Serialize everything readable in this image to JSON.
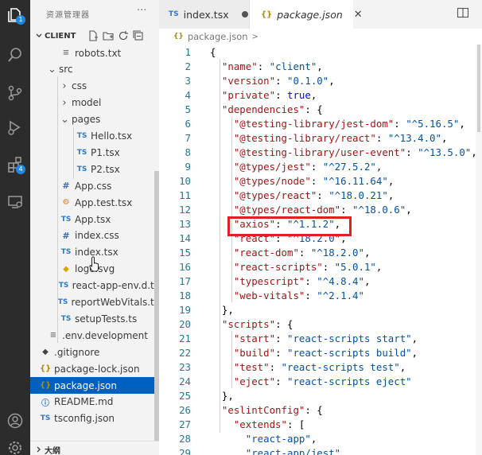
{
  "activity_bar": [
    {
      "name": "explorer-icon",
      "badge": "1"
    },
    {
      "name": "search-icon",
      "badge": ""
    },
    {
      "name": "source-control-icon",
      "badge": ""
    },
    {
      "name": "run-debug-icon",
      "badge": ""
    },
    {
      "name": "extensions-icon",
      "badge": "4"
    },
    {
      "name": "remote-explorer-icon",
      "badge": ""
    },
    {
      "name": "account-icon",
      "badge": ""
    },
    {
      "name": "settings-gear-icon",
      "badge": ""
    }
  ],
  "sidebar": {
    "title": "资源管理器",
    "more": "···",
    "section": "CLIENT",
    "outline": "大纲",
    "tree": [
      {
        "label": "robots.txt",
        "icon": "≡",
        "cls": "txt",
        "indent": 1,
        "chevron": ""
      },
      {
        "label": "src",
        "icon": "",
        "cls": "",
        "indent": 0,
        "chevron": "v"
      },
      {
        "label": "css",
        "icon": "",
        "cls": "",
        "indent": 1,
        "chevron": ">"
      },
      {
        "label": "model",
        "icon": "",
        "cls": "",
        "indent": 1,
        "chevron": ">"
      },
      {
        "label": "pages",
        "icon": "",
        "cls": "",
        "indent": 1,
        "chevron": "v"
      },
      {
        "label": "Hello.tsx",
        "icon": "TS",
        "cls": "ts",
        "indent": 2,
        "chevron": ""
      },
      {
        "label": "P1.tsx",
        "icon": "TS",
        "cls": "ts",
        "indent": 2,
        "chevron": ""
      },
      {
        "label": "P2.tsx",
        "icon": "TS",
        "cls": "ts",
        "indent": 2,
        "chevron": ""
      },
      {
        "label": "App.css",
        "icon": "#",
        "cls": "css",
        "indent": 1,
        "chevron": ""
      },
      {
        "label": "App.test.tsx",
        "icon": "⚙",
        "cls": "test",
        "indent": 1,
        "chevron": ""
      },
      {
        "label": "App.tsx",
        "icon": "TS",
        "cls": "ts",
        "indent": 1,
        "chevron": ""
      },
      {
        "label": "index.css",
        "icon": "#",
        "cls": "css",
        "indent": 1,
        "chevron": ""
      },
      {
        "label": "index.tsx",
        "icon": "TS",
        "cls": "ts",
        "indent": 1,
        "chevron": ""
      },
      {
        "label": "logo.svg",
        "icon": "◆",
        "cls": "svg",
        "indent": 1,
        "chevron": ""
      },
      {
        "label": "react-app-env.d.ts",
        "icon": "TS",
        "cls": "ts",
        "indent": 1,
        "chevron": ""
      },
      {
        "label": "reportWebVitals.ts",
        "icon": "TS",
        "cls": "ts",
        "indent": 1,
        "chevron": ""
      },
      {
        "label": "setupTests.ts",
        "icon": "TS",
        "cls": "ts",
        "indent": 1,
        "chevron": ""
      },
      {
        "label": ".env.development",
        "icon": "≡",
        "cls": "txt",
        "indent": 0,
        "chevron": ""
      },
      {
        "label": ".gitignore",
        "icon": "◆",
        "cls": "git",
        "indent": -1,
        "chevron": ""
      },
      {
        "label": "package-lock.json",
        "icon": "{}",
        "cls": "json",
        "indent": -1,
        "chevron": ""
      },
      {
        "label": "package.json",
        "icon": "{}",
        "cls": "json",
        "indent": -1,
        "chevron": "",
        "selected": true
      },
      {
        "label": "README.md",
        "icon": "ⓘ",
        "cls": "info",
        "indent": -1,
        "chevron": ""
      },
      {
        "label": "tsconfig.json",
        "icon": "TS",
        "cls": "ts",
        "indent": -1,
        "chevron": ""
      }
    ]
  },
  "tabs": [
    {
      "label": "index.tsx",
      "badge": "TS",
      "dirty": true
    },
    {
      "label": "package.json",
      "badge": "{}",
      "active": true
    }
  ],
  "breadcrumb": {
    "badge": "{}",
    "file": "package.json",
    "sep": ">"
  },
  "code_lines": [
    {
      "n": "1",
      "html": "<span class='punc'>{</span>"
    },
    {
      "n": "2",
      "html": "  <span class='key'>\"name\"</span>: <span class='str'>\"client\"</span>,"
    },
    {
      "n": "3",
      "html": "  <span class='key'>\"version\"</span>: <span class='str'>\"0.1.0\"</span>,"
    },
    {
      "n": "4",
      "html": "  <span class='key'>\"private\"</span>: <span class='kw'>true</span>,"
    },
    {
      "n": "5",
      "html": "  <span class='key'>\"dependencies\"</span>: {"
    },
    {
      "n": "6",
      "html": "    <span class='key'>\"@testing-library/jest-dom\"</span>: <span class='str'>\"^5.16.5\"</span>,"
    },
    {
      "n": "7",
      "html": "    <span class='key'>\"@testing-library/react\"</span>: <span class='str'>\"^13.4.0\"</span>,"
    },
    {
      "n": "8",
      "html": "    <span class='key'>\"@testing-library/user-event\"</span>: <span class='str'>\"^13.5.0\"</span>,"
    },
    {
      "n": "9",
      "html": "    <span class='key'>\"@types/jest\"</span>: <span class='str'>\"^27.5.2\"</span>,"
    },
    {
      "n": "10",
      "html": "    <span class='key'>\"@types/node\"</span>: <span class='str'>\"^16.11.64\"</span>,"
    },
    {
      "n": "11",
      "html": "    <span class='key'>\"@types/react\"</span>: <span class='str'>\"^18.0.21\"</span>,"
    },
    {
      "n": "12",
      "html": "    <span class='key'>\"@types/react-dom\"</span>: <span class='str'>\"^18.0.6\"</span>,"
    },
    {
      "n": "13",
      "html": "    <span class='key'>\"axios\"</span>: <span class='str'>\"^1.1.2\"</span>,"
    },
    {
      "n": "14",
      "html": "    <span class='key'>\"react\"</span>: <span class='str'>\"^18.2.0\"</span>,"
    },
    {
      "n": "15",
      "html": "    <span class='key'>\"react-dom\"</span>: <span class='str'>\"^18.2.0\"</span>,"
    },
    {
      "n": "16",
      "html": "    <span class='key'>\"react-scripts\"</span>: <span class='str'>\"5.0.1\"</span>,"
    },
    {
      "n": "17",
      "html": "    <span class='key'>\"typescript\"</span>: <span class='str'>\"^4.8.4\"</span>,"
    },
    {
      "n": "18",
      "html": "    <span class='key'>\"web-vitals\"</span>: <span class='str'>\"^2.1.4\"</span>"
    },
    {
      "n": "19",
      "html": "  },"
    },
    {
      "n": "20",
      "html": "  <span class='key'>\"scripts\"</span>: {"
    },
    {
      "n": "21",
      "html": "    <span class='key'>\"start\"</span>: <span class='str'>\"react-scripts start\"</span>,"
    },
    {
      "n": "22",
      "html": "    <span class='key'>\"build\"</span>: <span class='str'>\"react-scripts build\"</span>,"
    },
    {
      "n": "23",
      "html": "    <span class='key'>\"test\"</span>: <span class='str'>\"react-scripts test\"</span>,"
    },
    {
      "n": "24",
      "html": "    <span class='key'>\"eject\"</span>: <span class='str'>\"react-scripts eject\"</span>"
    },
    {
      "n": "25",
      "html": "  },"
    },
    {
      "n": "26",
      "html": "  <span class='key'>\"eslintConfig\"</span>: {"
    },
    {
      "n": "27",
      "html": "    <span class='key'>\"extends\"</span>: ["
    },
    {
      "n": "28",
      "html": "      <span class='str'>\"react-app\"</span>,"
    },
    {
      "n": "29",
      "html": "      <span class='str'>\"react-app/jest\"</span>"
    }
  ]
}
